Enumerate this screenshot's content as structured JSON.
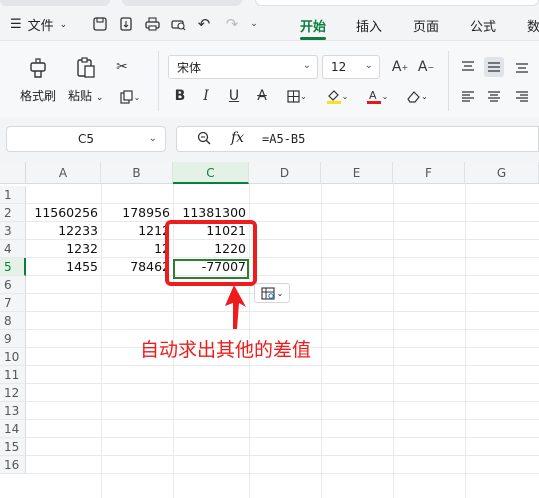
{
  "menu": {
    "file_label": "文件",
    "tabs": [
      "开始",
      "插入",
      "页面",
      "公式",
      "数"
    ],
    "active_tab": "开始"
  },
  "ribbon": {
    "format_painter": "格式刷",
    "paste": "粘贴",
    "font_name": "宋体",
    "font_size": "12"
  },
  "formula_bar": {
    "name_box": "C5",
    "fx_label": "fx",
    "formula": "=A5-B5"
  },
  "sheet": {
    "columns": [
      "A",
      "B",
      "C",
      "D",
      "E",
      "F",
      "G"
    ],
    "rows": [
      "1",
      "2",
      "3",
      "4",
      "5",
      "6",
      "7",
      "8",
      "9",
      "10",
      "11",
      "12",
      "13",
      "14",
      "15",
      "16"
    ],
    "cells": {
      "A2": "11560256",
      "B2": "178956",
      "C2": "11381300",
      "A3": "12233",
      "B3": "1212",
      "C3": "11021",
      "A4": "1232",
      "B4": "12",
      "C4": "1220",
      "A5": "1455",
      "B5": "78462",
      "C5": "-77007"
    },
    "selected_cell": "C5"
  },
  "annotation": {
    "text": "自动求出其他的差值",
    "color": "#ee1c1c"
  },
  "colors": {
    "accent": "#0b7d3e",
    "highlight": "#ee1c1c"
  }
}
